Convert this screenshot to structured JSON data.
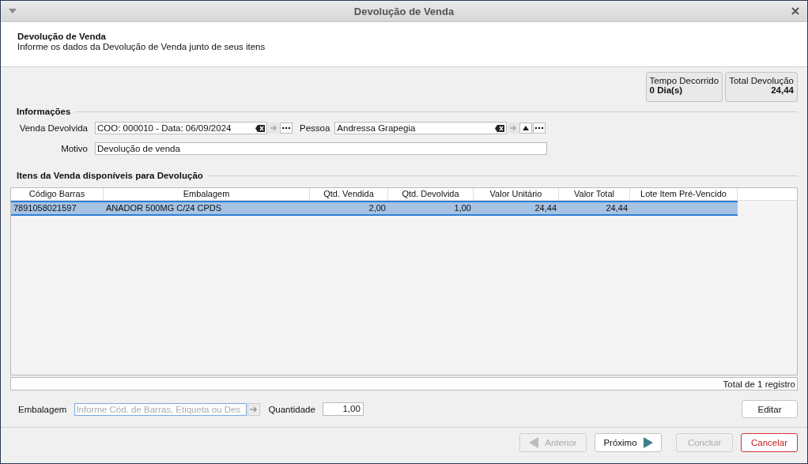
{
  "window": {
    "title": "Devolução de Venda"
  },
  "header": {
    "title": "Devolução de Venda",
    "subtitle": "Informe os dados da Devolução de Venda junto de seus itens"
  },
  "summary": [
    {
      "label": "Tempo Decorrido",
      "value": "0 Dia(s)",
      "kind": "text"
    },
    {
      "label": "Total Devolução",
      "value": "24,44",
      "kind": "amount"
    }
  ],
  "informacoes": {
    "heading": "Informações",
    "venda_devolvida": {
      "label": "Venda Devolvida",
      "value": "COO: 000010 - Data: 06/09/2024"
    },
    "pessoa": {
      "label": "Pessoa",
      "value": "Andressa Grapegia"
    },
    "motivo": {
      "label": "Motivo",
      "value": "Devolução de venda"
    }
  },
  "items": {
    "heading": "Itens da Venda disponíveis para Devolução",
    "columns": [
      {
        "label": "Código Barras",
        "kind": "text"
      },
      {
        "label": "Embalagem",
        "kind": "text"
      },
      {
        "label": "Qtd. Vendida",
        "kind": "number"
      },
      {
        "label": "Qtd. Devolvida",
        "kind": "number"
      },
      {
        "label": "Valor Unitário",
        "kind": "number"
      },
      {
        "label": "Valor Total",
        "kind": "number"
      },
      {
        "label": "Lote Item Pré-Vencido"
      }
    ],
    "rows": [
      {
        "selected": true,
        "cells": [
          "7891058021597",
          "ANADOR 500MG C/24 CPDS",
          "2,00",
          "1,00",
          "24,44",
          "24,44",
          null
        ]
      }
    ],
    "footer": "Total de 1 registro"
  },
  "embalagem": {
    "label": "Embalagem",
    "placeholder": "Informe Cód. de Barras, Etiqueta ou Des"
  },
  "quantidade": {
    "label": "Quantidade",
    "value": "1,00"
  },
  "edit_button": {
    "label": "Editar"
  },
  "nav_buttons": [
    {
      "label": "Anterior",
      "kind": "prev",
      "disabled": true
    },
    {
      "label": "Próximo",
      "kind": "next",
      "disabled": false
    },
    {
      "label": "Concluir",
      "kind": "plain",
      "disabled": true
    },
    {
      "label": "Cancelar",
      "kind": "cancel",
      "disabled": false
    }
  ]
}
